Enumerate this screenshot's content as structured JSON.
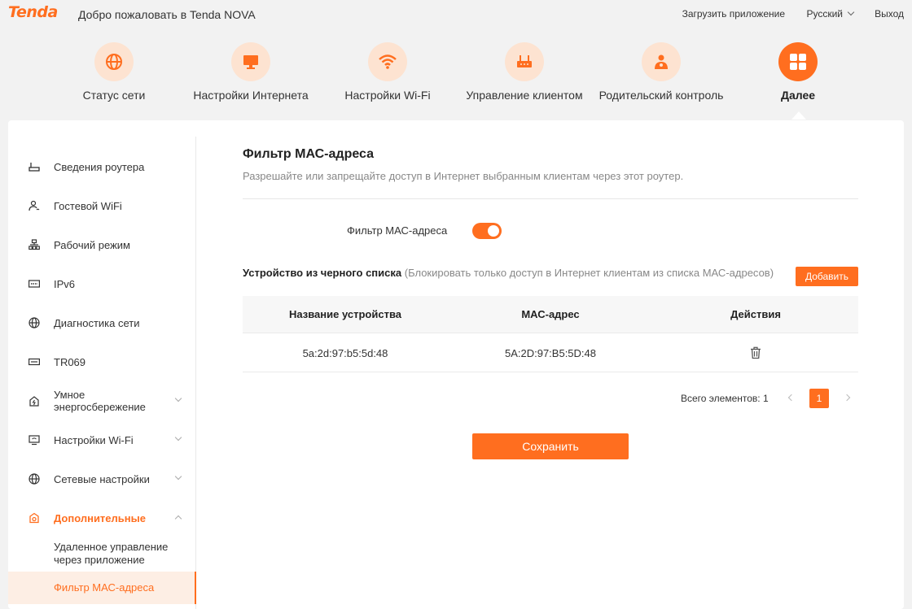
{
  "header": {
    "logo": "Tenda",
    "welcome": "Добро пожаловать в Tenda NOVA",
    "download_app": "Загрузить приложение",
    "language": "Русский",
    "logout": "Выход"
  },
  "nav": [
    {
      "label": "Статус сети",
      "icon": "globe-icon"
    },
    {
      "label": "Настройки Интернета",
      "icon": "monitor-icon"
    },
    {
      "label": "Настройки Wi-Fi",
      "icon": "wifi-icon"
    },
    {
      "label": "Управление клиентом",
      "icon": "router-icon"
    },
    {
      "label": "Родительский контроль",
      "icon": "parent-icon"
    },
    {
      "label": "Далее",
      "icon": "grid-icon",
      "active": true
    }
  ],
  "sidebar": {
    "items": [
      {
        "label": "Сведения роутера",
        "icon": "router-info-icon"
      },
      {
        "label": "Гостевой WiFi",
        "icon": "guest-wifi-icon"
      },
      {
        "label": "Рабочий режим",
        "icon": "work-mode-icon"
      },
      {
        "label": "IPv6",
        "icon": "ipv6-icon"
      },
      {
        "label": "Диагностика сети",
        "icon": "globe-icon"
      },
      {
        "label": "TR069",
        "icon": "tr069-icon"
      },
      {
        "label": "Умное энергосбережение",
        "icon": "energy-icon"
      },
      {
        "label": "Настройки Wi-Fi",
        "icon": "wifi-settings-icon"
      },
      {
        "label": "Сетевые настройки",
        "icon": "globe-icon"
      },
      {
        "label": "Дополнительные",
        "icon": "advanced-icon"
      }
    ],
    "sub_items": [
      {
        "label": "Удаленное управление через приложение"
      },
      {
        "label": "Фильтр МАС-адреса",
        "active": true
      }
    ]
  },
  "content": {
    "title": "Фильтр МАС-адреса",
    "subtitle": "Разрешайте или запрещайте доступ в Интернет выбранным клиентам через этот роутер.",
    "switch_label": "Фильтр МАС-адреса",
    "switch_on": true,
    "blacklist_title": "Устройство из черного списка",
    "blacklist_note": "(Блокировать только доступ в Интернет клиентам из списка МАС-адресов)",
    "add_button": "Добавить",
    "table": {
      "headers": [
        "Название устройства",
        "МАС-адрес",
        "Действия"
      ],
      "rows": [
        {
          "name": "5a:2d:97:b5:5d:48",
          "mac": "5A:2D:97:B5:5D:48"
        }
      ]
    },
    "pagination": {
      "total_label": "Всего элементов: 1",
      "current_page": "1"
    },
    "save_button": "Сохранить"
  },
  "colors": {
    "accent": "#ff6e1f",
    "accent_light": "#fde3d1"
  }
}
